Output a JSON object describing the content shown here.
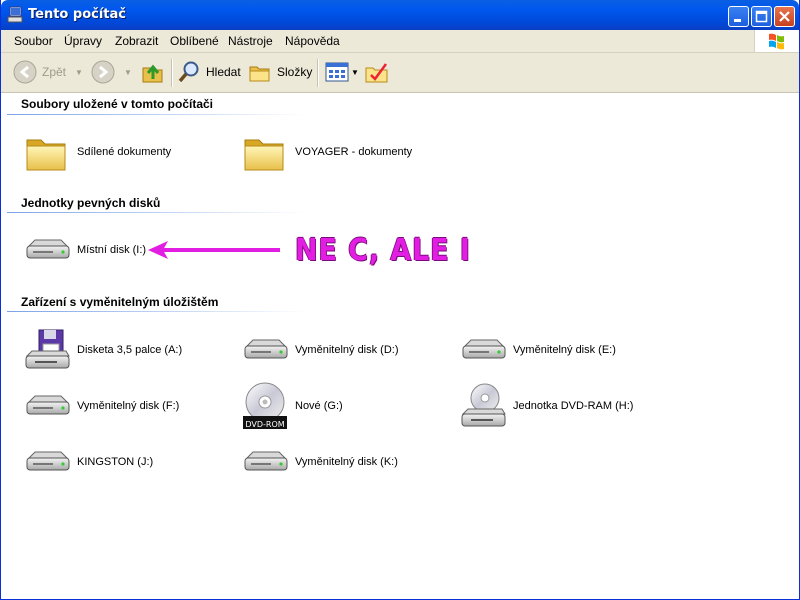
{
  "window": {
    "title": "Tento počítač"
  },
  "menu": {
    "items": [
      "Soubor",
      "Úpravy",
      "Zobrazit",
      "Oblíbené",
      "Nástroje",
      "Nápověda"
    ]
  },
  "toolbar": {
    "back_label": "Zpět",
    "search_label": "Hledat",
    "folders_label": "Složky"
  },
  "groups": [
    {
      "title": "Soubory uložené v tomto počítači",
      "items": [
        {
          "label": "Sdílené dokumenty",
          "icon": "folder-icon"
        },
        {
          "label": "VOYAGER - dokumenty",
          "icon": "folder-icon"
        }
      ]
    },
    {
      "title": "Jednotky pevných disků",
      "items": [
        {
          "label": "Místní disk (I:)",
          "icon": "hard-disk-icon"
        }
      ]
    },
    {
      "title": "Zařízení s vyměnitelným úložištěm",
      "items": [
        {
          "label": "Disketa 3,5 palce (A:)",
          "icon": "floppy-drive-icon"
        },
        {
          "label": "Vyměnitelný disk (D:)",
          "icon": "removable-disk-icon"
        },
        {
          "label": "Vyměnitelný disk (E:)",
          "icon": "removable-disk-icon"
        },
        {
          "label": "Vyměnitelný disk (F:)",
          "icon": "removable-disk-icon"
        },
        {
          "label": "Nové (G:)",
          "icon": "dvd-disc-icon"
        },
        {
          "label": "Jednotka DVD-RAM (H:)",
          "icon": "dvd-ram-drive-icon"
        },
        {
          "label": "KINGSTON (J:)",
          "icon": "removable-disk-icon"
        },
        {
          "label": "Vyměnitelný disk (K:)",
          "icon": "removable-disk-icon"
        }
      ]
    }
  ],
  "dvd_badge": "DVD-ROM",
  "annotation": {
    "text": "NE C, ALE I",
    "color": "#e31ee3"
  }
}
